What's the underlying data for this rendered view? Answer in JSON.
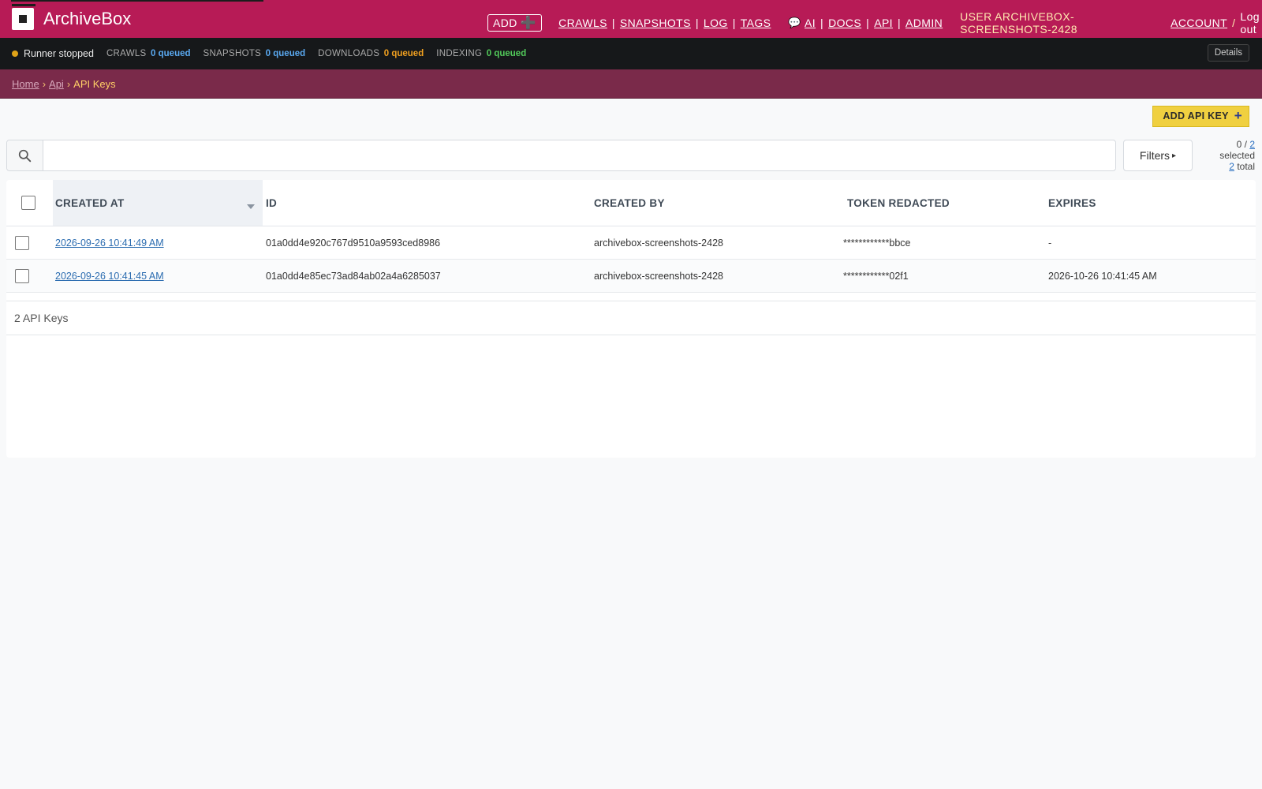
{
  "header": {
    "brand": "ArchiveBox",
    "add_label": "ADD",
    "add_plus": "➕",
    "nav": [
      "CRAWLS",
      "SNAPSHOTS",
      "LOG",
      "TAGS"
    ],
    "chat_icon": "💬",
    "tools": [
      "AI",
      "DOCS",
      "API",
      "ADMIN"
    ],
    "user_label": "USER ARCHIVEBOX-SCREENSHOTS-2428",
    "account_label": "ACCOUNT",
    "slash": "/",
    "logout_label": "Log out",
    "nav_sep": "|"
  },
  "status": {
    "runner": "Runner stopped",
    "dot_color": "#e0a318",
    "crawls_label": "CRAWLS",
    "crawls_value": "0 queued",
    "snapshots_label": "SNAPSHOTS",
    "snapshots_value": "0 queued",
    "downloads_label": "DOWNLOADS",
    "downloads_value": "0 queued",
    "indexing_label": "INDEXING",
    "indexing_value": "0 queued",
    "details_label": "Details"
  },
  "breadcrumb": {
    "home": "Home",
    "api": "Api",
    "current": "API Keys",
    "sep": "›"
  },
  "actions": {
    "add_key_label": "ADD API KEY",
    "add_key_plus": "+"
  },
  "search": {
    "value": "",
    "placeholder": "",
    "filters_label": "Filters",
    "filters_arrow": "▸",
    "selected_count": "0",
    "selected_total": "2",
    "selected_suffix": "selected",
    "total_count": "2",
    "total_suffix": "total",
    "of": "/"
  },
  "table": {
    "columns": [
      "CREATED AT",
      "ID",
      "CREATED BY",
      "TOKEN REDACTED",
      "EXPIRES"
    ],
    "rows": [
      {
        "created_at": "2026-09-26 10:41:49 AM",
        "id": "01a0dd4e920c767d9510a9593ced8986",
        "created_by": "archivebox-screenshots-2428",
        "token": "************bbce",
        "expires": "-"
      },
      {
        "created_at": "2026-09-26 10:41:45 AM",
        "id": "01a0dd4e85ec73ad84ab02a4a6285037",
        "created_by": "archivebox-screenshots-2428",
        "token": "************02f1",
        "expires": "2026-10-26 10:41:45 AM"
      }
    ],
    "footer": "2 API Keys"
  },
  "colors": {
    "header_bg": "#b71b56",
    "breadcrumb_bg": "#7a2a4a",
    "add_key_bg": "#f0d040"
  }
}
